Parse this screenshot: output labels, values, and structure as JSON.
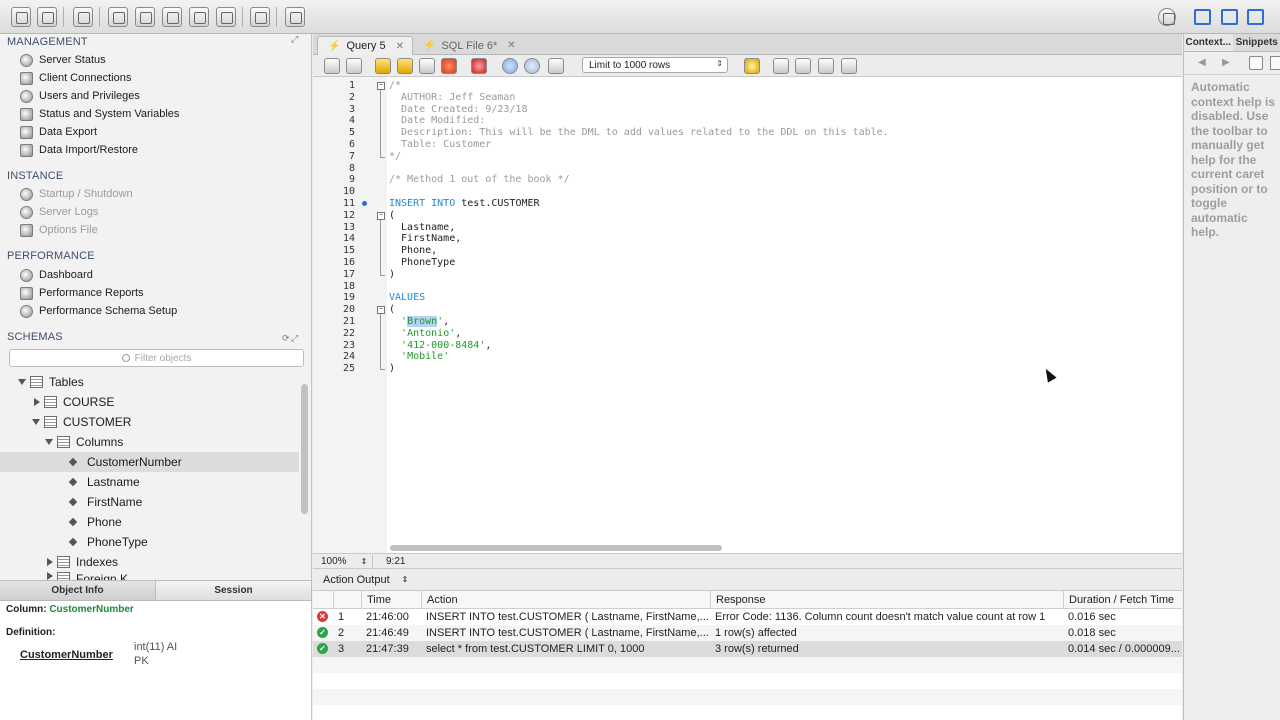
{
  "sidebar": {
    "management_title": "MANAGEMENT",
    "management_items": [
      "Server Status",
      "Client Connections",
      "Users and Privileges",
      "Status and System Variables",
      "Data Export",
      "Data Import/Restore"
    ],
    "instance_title": "INSTANCE",
    "instance_items": [
      "Startup / Shutdown",
      "Server Logs",
      "Options File"
    ],
    "performance_title": "PERFORMANCE",
    "performance_items": [
      "Dashboard",
      "Performance Reports",
      "Performance Schema Setup"
    ],
    "schemas_title": "SCHEMAS",
    "filter_placeholder": "Filter objects",
    "tree": {
      "tables": "Tables",
      "course": "COURSE",
      "customer": "CUSTOMER",
      "columns": "Columns",
      "column_items": [
        "CustomerNumber",
        "Lastname",
        "FirstName",
        "Phone",
        "PhoneType"
      ],
      "indexes": "Indexes",
      "foreign_keys_partial": "Foreign K..."
    }
  },
  "info_panel": {
    "tabs": [
      "Object Info",
      "Session"
    ],
    "column_label": "Column:",
    "column_value": "CustomerNumber",
    "definition_label": "Definition:",
    "def_name": "CustomerNumber",
    "def_type": "int(11) AI",
    "def_key": "PK"
  },
  "editor": {
    "tabs": [
      {
        "label": "Query 5",
        "active": true
      },
      {
        "label": "SQL File 6*",
        "active": false
      }
    ],
    "limit_select": "Limit to 1000 rows",
    "zoom": "100%",
    "cursor_position": "9:21",
    "lines": [
      "/*",
      "  AUTHOR: Jeff Seaman",
      "  Date Created: 9/23/18",
      "  Date Modified:",
      "  Description: This will be the DML to add values related to the DDL on this table.",
      "  Table: Customer",
      "*/",
      "",
      "/* Method 1 out of the book */",
      "",
      "INSERT INTO test.CUSTOMER",
      "(",
      "  Lastname,",
      "  FirstName,",
      "  Phone,",
      "  PhoneType",
      ")",
      "",
      "VALUES",
      "(",
      "  'Brown',",
      "  'Antonio',",
      "  '412-000-8484',",
      "  'Mobile'",
      ")"
    ]
  },
  "output": {
    "title": "Action Output",
    "columns": [
      "",
      "Time",
      "Action",
      "Response",
      "Duration / Fetch Time"
    ],
    "rows": [
      {
        "status": "error",
        "num": "1",
        "time": "21:46:00",
        "action": "INSERT INTO test.CUSTOMER (   Lastname,   FirstName,...",
        "response": "Error Code: 1136. Column count doesn't match value count at row 1",
        "duration": "0.016 sec"
      },
      {
        "status": "ok",
        "num": "2",
        "time": "21:46:49",
        "action": "INSERT INTO test.CUSTOMER (   Lastname,   FirstName,...",
        "response": "1 row(s) affected",
        "duration": "0.018 sec"
      },
      {
        "status": "ok",
        "num": "3",
        "time": "21:47:39",
        "action": "select * from test.CUSTOMER LIMIT 0, 1000",
        "response": "3 row(s) returned",
        "duration": "0.014 sec / 0.000009..."
      }
    ]
  },
  "right_panel": {
    "tabs": [
      "Context...",
      "Snippets"
    ],
    "help_text": "Automatic context help is disabled. Use the toolbar to manually get help for the current caret position or to toggle automatic help."
  },
  "colors": {
    "keyword": "#1f8bd6",
    "string": "#1f9a2d",
    "comment": "#9a9a9a",
    "accent": "#2e6cd8",
    "error": "#d83b3b",
    "ok": "#2aa745"
  }
}
